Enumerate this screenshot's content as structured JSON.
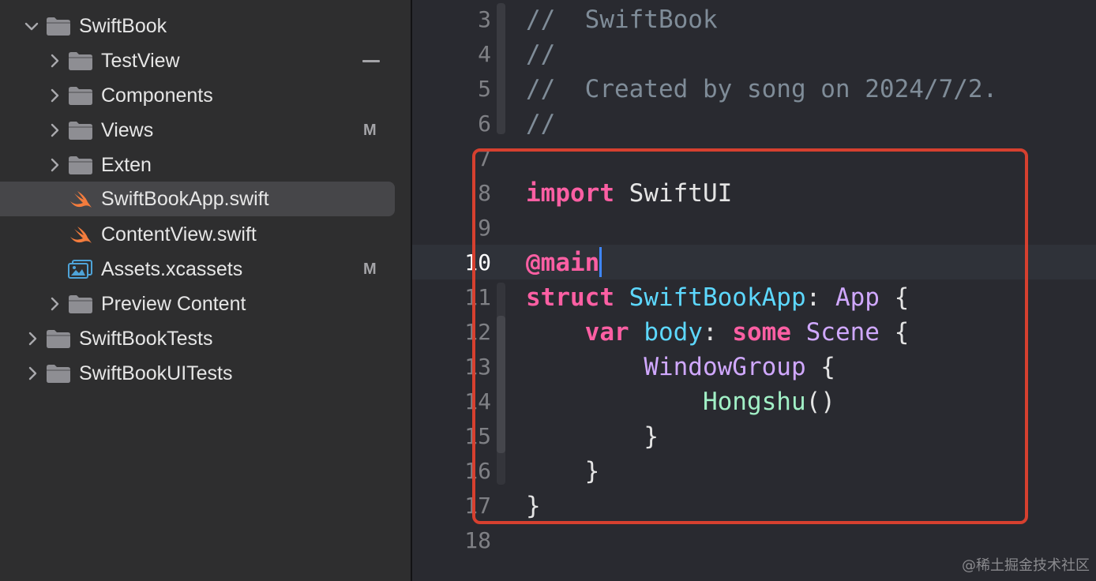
{
  "navigator": {
    "items": [
      {
        "label": "SwiftBook",
        "icon": "folder-icon",
        "expanded": true
      },
      {
        "label": "TestView",
        "icon": "folder-icon",
        "status": "—"
      },
      {
        "label": "Components",
        "icon": "folder-icon"
      },
      {
        "label": "Views",
        "icon": "folder-icon",
        "status": "M"
      },
      {
        "label": "Exten",
        "icon": "folder-icon"
      },
      {
        "label": "SwiftBookApp.swift",
        "icon": "swift-file-icon",
        "selected": true
      },
      {
        "label": "ContentView.swift",
        "icon": "swift-file-icon"
      },
      {
        "label": "Assets.xcassets",
        "icon": "asset-catalog-icon",
        "status": "M"
      },
      {
        "label": "Preview Content",
        "icon": "folder-icon"
      },
      {
        "label": "SwiftBookTests",
        "icon": "folder-icon"
      },
      {
        "label": "SwiftBookUITests",
        "icon": "folder-icon"
      }
    ]
  },
  "editor": {
    "current_line": "10",
    "line_numbers": [
      "3",
      "4",
      "5",
      "6",
      "7",
      "8",
      "9",
      "10",
      "11",
      "12",
      "13",
      "14",
      "15",
      "16",
      "17",
      "18"
    ],
    "tokens": {
      "c1": "//  SwiftBook",
      "c2": "//",
      "c3": "//  Created by song on 2024/7/2.",
      "c4": "//",
      "import_kw": "import",
      "import_mod": "SwiftUI",
      "main_attr": "@main",
      "struct_kw": "struct",
      "struct_name": "SwiftBookApp",
      "colon1": ": ",
      "protocol": "App",
      "brace1": " {",
      "var_kw": "var",
      "body_name": "body",
      "colon2": ": ",
      "some_kw": "some",
      "scene_type": "Scene",
      "brace2": " {",
      "window_group": "WindowGroup",
      "brace3": " {",
      "hongshu": "Hongshu",
      "parens": "()",
      "close3": "}",
      "close2": "}",
      "close1": "}"
    }
  },
  "colors": {
    "comment": "#7f8c98",
    "keyword": "#fc5fa3",
    "type_declaration": "#5dd8ff",
    "type": "#d0a8ff",
    "function": "#a1f0c6",
    "highlight_box": "#d6402f",
    "caret": "#3f86ff"
  },
  "watermark": "@稀土掘金技术社区"
}
